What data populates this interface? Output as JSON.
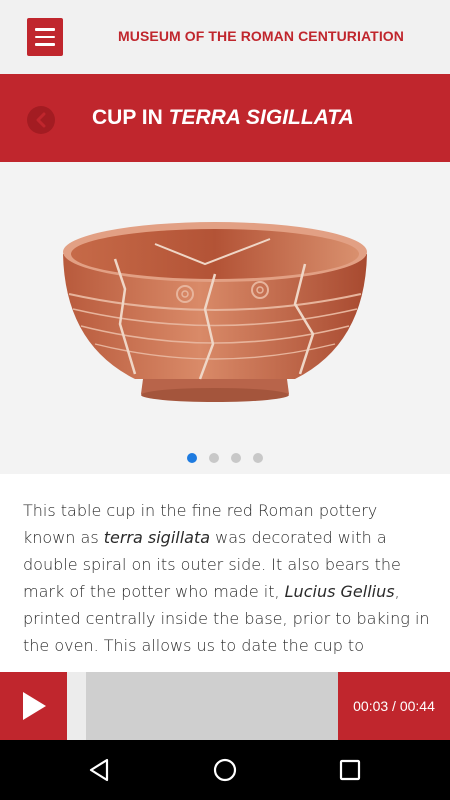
{
  "app": {
    "title": "MUSEUM OF THE ROMAN CENTURIATION",
    "menu_icon": "hamburger-menu-icon"
  },
  "header": {
    "title_prefix": "CUP IN ",
    "title_italic": "TERRA SIGILLATA",
    "back_icon": "chevron-left-icon"
  },
  "gallery": {
    "slide_count": 4,
    "active_slide": 1
  },
  "description": {
    "p1": "This table cup in the fine red Roman pottery known as ",
    "p1_italic": "terra sigillata",
    "p2": " was decorated with a double spiral on its outer side. It also bears the mark of the potter who made it, ",
    "p2_italic": "Lucius Gellius",
    "p3": ", printed centrally inside the base, prior to baking in the oven. This allows us to date the cup to"
  },
  "player": {
    "time": "00:03 / 00:44",
    "progress": 0.068,
    "play_icon": "play-icon"
  },
  "system_nav": {
    "back_icon": "nav-back-icon",
    "home_icon": "nav-home-icon",
    "recent_icon": "nav-recent-apps-icon"
  },
  "colors": {
    "accent": "#c0262d",
    "dot_active": "#1e7be0",
    "dot_inactive": "#c8c8c8"
  }
}
